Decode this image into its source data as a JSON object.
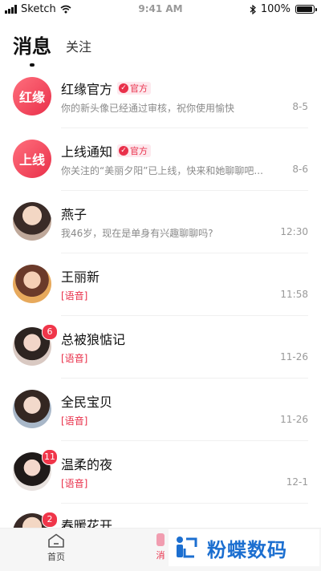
{
  "status": {
    "carrier": "Sketch",
    "time": "9:41 AM",
    "battery": "100%"
  },
  "tabs": [
    {
      "label": "消息",
      "active": true
    },
    {
      "label": "关注",
      "active": false
    }
  ],
  "conversations": [
    {
      "avatar_text": "红缘",
      "name": "红缘官方",
      "official_label": "官方",
      "preview": "你的新头像已经通过审核，祝你使用愉快",
      "time": "8-5"
    },
    {
      "avatar_text": "上线",
      "name": "上线通知",
      "official_label": "官方",
      "preview": "你关注的“美丽夕阳”已上线，快来和她聊聊吧...",
      "time": "8-6"
    },
    {
      "name": "燕子",
      "preview": "我46岁，现在是单身有兴趣聊聊吗?",
      "time": "12:30"
    },
    {
      "name": "王丽新",
      "preview": "[语音]",
      "time": "11:58"
    },
    {
      "name": "总被狼惦记",
      "badge": "6",
      "preview": "[语音]",
      "time": "11-26"
    },
    {
      "name": "全民宝贝",
      "preview": "[语音]",
      "time": "11-26"
    },
    {
      "name": "温柔的夜",
      "badge": "11",
      "preview": "[语音]",
      "time": "12-1"
    },
    {
      "name": "春暖花开",
      "badge": "2"
    }
  ],
  "bottom_nav": {
    "home_label": "首页",
    "messages_label": "消"
  },
  "watermark": {
    "text": "粉蝶数码"
  },
  "colors": {
    "accent": "#e9304a",
    "badge": "#f0364a",
    "watermark": "#1c6fd0"
  }
}
